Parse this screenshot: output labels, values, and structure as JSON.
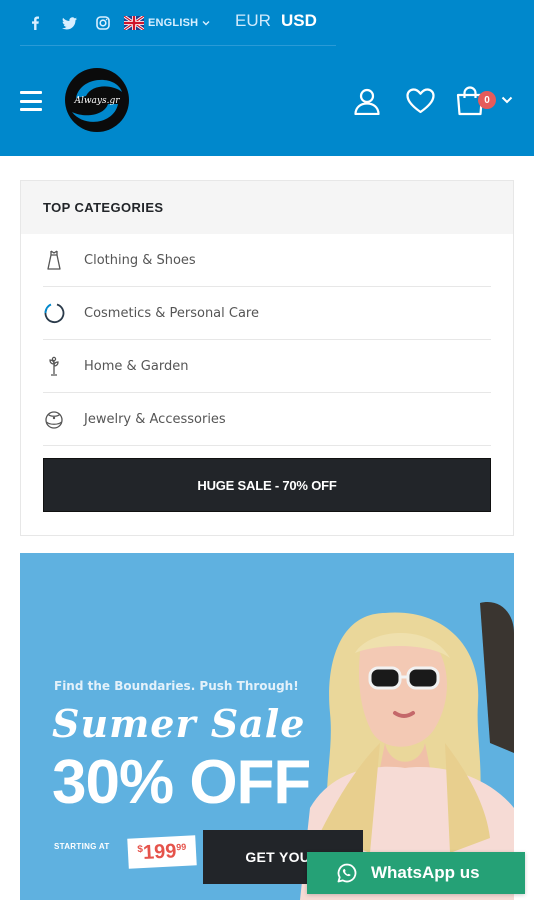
{
  "topbar": {
    "social_icons": [
      "facebook-icon",
      "twitter-icon",
      "instagram-icon"
    ],
    "language": "ENGLISH",
    "currencies": [
      "EUR",
      "USD"
    ],
    "active_currency": "USD"
  },
  "header": {
    "logo_text": "Always.gr",
    "cart_count": "0"
  },
  "categories": {
    "title": "TOP CATEGORIES",
    "items": [
      {
        "label": "Clothing & Shoes",
        "icon": "dress-icon"
      },
      {
        "label": "Cosmetics & Personal Care",
        "icon": "cosmetics-icon"
      },
      {
        "label": "Home & Garden",
        "icon": "plant-icon"
      },
      {
        "label": "Jewelry & Accessories",
        "icon": "jewelry-icon"
      }
    ],
    "sale_button": "HUGE SALE - 70% OFF"
  },
  "banner": {
    "pretitle": "Find the Boundaries. Push Through!",
    "script_title": "Sumer Sale",
    "headline": "30% OFF",
    "starting_label": "STARTING AT",
    "price_currency": "$",
    "price_amount": "199",
    "price_cents": "99",
    "cta": "GET YOUR"
  },
  "whatsapp": {
    "label": "WhatsApp us"
  },
  "colors": {
    "primary": "#0088cc",
    "dark": "#222529",
    "banner_bg": "#5fb1e0",
    "badge": "#e55b5b",
    "whatsapp": "#25a176",
    "price": "#e5534b"
  }
}
